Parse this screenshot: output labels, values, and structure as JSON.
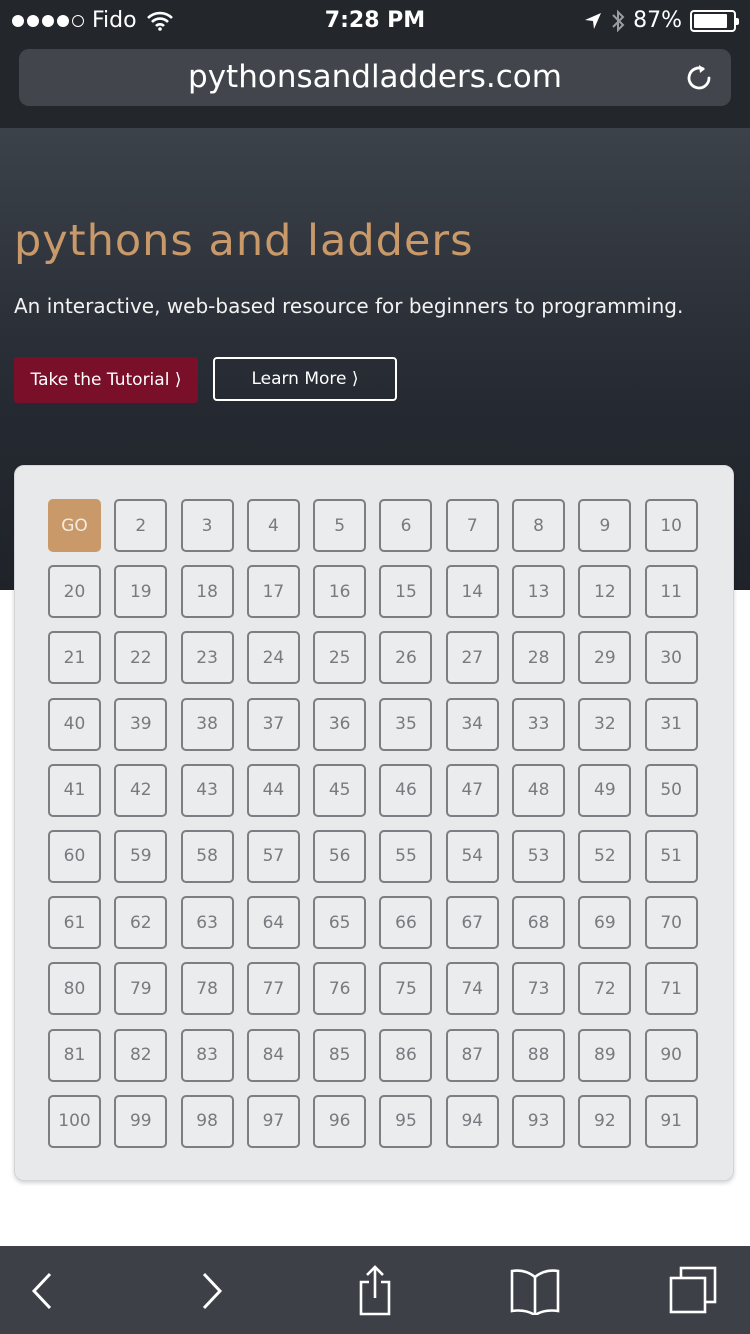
{
  "status_bar": {
    "carrier": "Fido",
    "time": "7:28 PM",
    "battery_percent": "87%",
    "battery_level": 0.87
  },
  "browser": {
    "url": "pythonsandladders.com",
    "reload_icon": "reload-icon"
  },
  "hero": {
    "title": "pythons and ladders",
    "subtitle": "An interactive, web-based resource for beginners to programming.",
    "primary_button": "Take the Tutorial ⟩",
    "secondary_button": "Learn More ⟩",
    "title_color": "#c9996a",
    "primary_color": "#7a0f2a"
  },
  "board": {
    "rows": [
      [
        "GO",
        "2",
        "3",
        "4",
        "5",
        "6",
        "7",
        "8",
        "9",
        "10"
      ],
      [
        "20",
        "19",
        "18",
        "17",
        "16",
        "15",
        "14",
        "13",
        "12",
        "11"
      ],
      [
        "21",
        "22",
        "23",
        "24",
        "25",
        "26",
        "27",
        "28",
        "29",
        "30"
      ],
      [
        "40",
        "39",
        "38",
        "37",
        "36",
        "35",
        "34",
        "33",
        "32",
        "31"
      ],
      [
        "41",
        "42",
        "43",
        "44",
        "45",
        "46",
        "47",
        "48",
        "49",
        "50"
      ],
      [
        "60",
        "59",
        "58",
        "57",
        "56",
        "55",
        "54",
        "53",
        "52",
        "51"
      ],
      [
        "61",
        "62",
        "63",
        "64",
        "65",
        "66",
        "67",
        "68",
        "69",
        "70"
      ],
      [
        "80",
        "79",
        "78",
        "77",
        "76",
        "75",
        "74",
        "73",
        "72",
        "71"
      ],
      [
        "81",
        "82",
        "83",
        "84",
        "85",
        "86",
        "87",
        "88",
        "89",
        "90"
      ],
      [
        "100",
        "99",
        "98",
        "97",
        "96",
        "95",
        "94",
        "93",
        "92",
        "91"
      ]
    ],
    "go_color": "#c9996a"
  },
  "toolbar": {
    "icons": [
      "back-icon",
      "forward-icon",
      "share-icon",
      "bookmarks-icon",
      "tabs-icon"
    ]
  }
}
